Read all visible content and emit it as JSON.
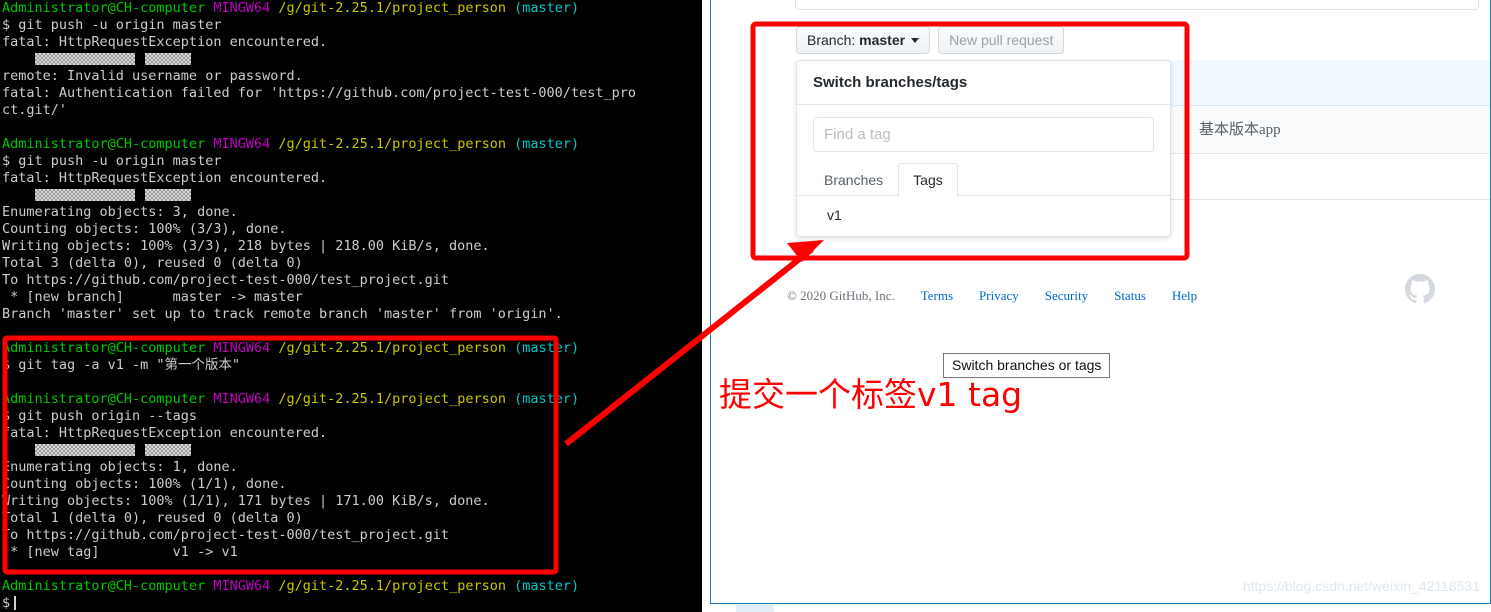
{
  "terminal": {
    "lines": [
      {
        "id": "l1",
        "type": "prompt",
        "user": "Administrator@CH-computer",
        "shell": "MINGW64",
        "path": "/g/git-2.25.1/project_person",
        "branch": "(master)"
      },
      {
        "id": "l2",
        "type": "text",
        "text": "$ git push -u origin master"
      },
      {
        "id": "l3",
        "type": "text",
        "text": "fatal: HttpRequestException encountered."
      },
      {
        "id": "l4",
        "type": "masked"
      },
      {
        "id": "l5",
        "type": "text",
        "text": "remote: Invalid username or password."
      },
      {
        "id": "l6",
        "type": "text",
        "text": "fatal: Authentication failed for 'https://github.com/project-test-000/test_pro"
      },
      {
        "id": "l7",
        "type": "text",
        "text": "ct.git/'"
      },
      {
        "id": "l8",
        "type": "blank"
      },
      {
        "id": "l9",
        "type": "prompt",
        "user": "Administrator@CH-computer",
        "shell": "MINGW64",
        "path": "/g/git-2.25.1/project_person",
        "branch": "(master)"
      },
      {
        "id": "l10",
        "type": "text",
        "text": "$ git push -u origin master"
      },
      {
        "id": "l11",
        "type": "text",
        "text": "fatal: HttpRequestException encountered."
      },
      {
        "id": "l12",
        "type": "masked"
      },
      {
        "id": "l13",
        "type": "text",
        "text": "Enumerating objects: 3, done."
      },
      {
        "id": "l14",
        "type": "text",
        "text": "Counting objects: 100% (3/3), done."
      },
      {
        "id": "l15",
        "type": "text",
        "text": "Writing objects: 100% (3/3), 218 bytes | 218.00 KiB/s, done."
      },
      {
        "id": "l16",
        "type": "text",
        "text": "Total 3 (delta 0), reused 0 (delta 0)"
      },
      {
        "id": "l17",
        "type": "text",
        "text": "To https://github.com/project-test-000/test_project.git"
      },
      {
        "id": "l18",
        "type": "text",
        "text": " * [new branch]      master -> master"
      },
      {
        "id": "l19",
        "type": "text",
        "text": "Branch 'master' set up to track remote branch 'master' from 'origin'."
      },
      {
        "id": "l20",
        "type": "blank"
      },
      {
        "id": "l21",
        "type": "prompt",
        "user": "Administrator@CH-computer",
        "shell": "MINGW64",
        "path": "/g/git-2.25.1/project_person",
        "branch": "(master)"
      },
      {
        "id": "l22",
        "type": "text",
        "text": "$ git tag -a v1 -m \"第一个版本\""
      },
      {
        "id": "l23",
        "type": "blank"
      },
      {
        "id": "l24",
        "type": "prompt",
        "user": "Administrator@CH-computer",
        "shell": "MINGW64",
        "path": "/g/git-2.25.1/project_person",
        "branch": "(master)"
      },
      {
        "id": "l25",
        "type": "text",
        "text": "$ git push origin --tags"
      },
      {
        "id": "l26",
        "type": "text",
        "text": "fatal: HttpRequestException encountered."
      },
      {
        "id": "l27",
        "type": "masked"
      },
      {
        "id": "l28",
        "type": "text",
        "text": "Enumerating objects: 1, done."
      },
      {
        "id": "l29",
        "type": "text",
        "text": "Counting objects: 100% (1/1), done."
      },
      {
        "id": "l30",
        "type": "text",
        "text": "Writing objects: 100% (1/1), 171 bytes | 171.00 KiB/s, done."
      },
      {
        "id": "l31",
        "type": "text",
        "text": "Total 1 (delta 0), reused 0 (delta 0)"
      },
      {
        "id": "l32",
        "type": "text",
        "text": "To https://github.com/project-test-000/test_project.git"
      },
      {
        "id": "l33",
        "type": "text",
        "text": " * [new tag]         v1 -> v1"
      },
      {
        "id": "l34",
        "type": "blank"
      },
      {
        "id": "l35",
        "type": "prompt",
        "user": "Administrator@CH-computer",
        "shell": "MINGW64",
        "path": "/g/git-2.25.1/project_person",
        "branch": "(master)"
      },
      {
        "id": "l36",
        "type": "cursor",
        "text": "$"
      }
    ],
    "colors": {
      "background": "#000000",
      "foreground": "#cccccc",
      "user": "#00c800",
      "shell": "#c000c0",
      "path": "#c8c800",
      "branch": "#00c8c8"
    }
  },
  "browser": {
    "branch_button": {
      "prefix": "Branch:",
      "value": "master"
    },
    "new_pull_request_label": "New pull request",
    "dropdown": {
      "header": "Switch branches/tags",
      "search_placeholder": "Find a tag",
      "search_value": "",
      "tabs": [
        {
          "label": "Branches",
          "active": false
        },
        {
          "label": "Tags",
          "active": true
        }
      ],
      "items": [
        {
          "label": "v1"
        }
      ]
    },
    "background_row_label": "基本版本app",
    "footer": {
      "copyright": "© 2020 GitHub, Inc.",
      "links": [
        "Terms",
        "Privacy",
        "Security",
        "Status",
        "Help"
      ]
    },
    "tooltip": "Switch branches or tags",
    "watermark": "https://blog.csdn.net/weixin_42118531"
  },
  "annotations": {
    "chinese_note": "提交一个标签v1 tag",
    "highlight_color": "#ff0000"
  }
}
